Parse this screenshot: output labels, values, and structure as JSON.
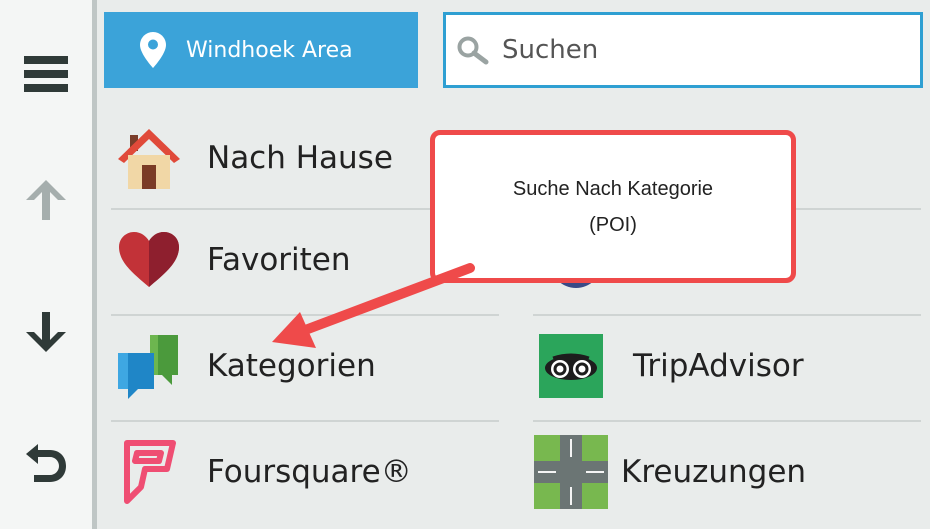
{
  "sidebar": {
    "menu_icon": "hamburger-menu-icon",
    "up_icon": "arrow-up-icon",
    "down_icon": "arrow-down-icon",
    "back_icon": "back-arrow-icon"
  },
  "header": {
    "area_label": "Windhoek Area",
    "area_icon": "location-pin-icon",
    "search_placeholder": "Suchen",
    "search_icon": "search-icon"
  },
  "menu": {
    "items": [
      {
        "label": "Nach Hause",
        "icon": "home-icon"
      },
      {
        "label": "Favoriten",
        "icon": "heart-icon"
      },
      {
        "label": "Kategorien",
        "icon": "categories-icon"
      },
      {
        "label": "TripAdvisor",
        "icon": "tripadvisor-icon"
      },
      {
        "label": "Foursquare®",
        "icon": "foursquare-icon"
      },
      {
        "label": "Kreuzungen",
        "icon": "intersection-icon"
      }
    ]
  },
  "callout": {
    "line1": "Suche Nach Kategorie",
    "line2": "(POI)"
  },
  "colors": {
    "accent": "#3ba3d9",
    "callout_border": "#ef4a4a",
    "background": "#e9eceb"
  }
}
